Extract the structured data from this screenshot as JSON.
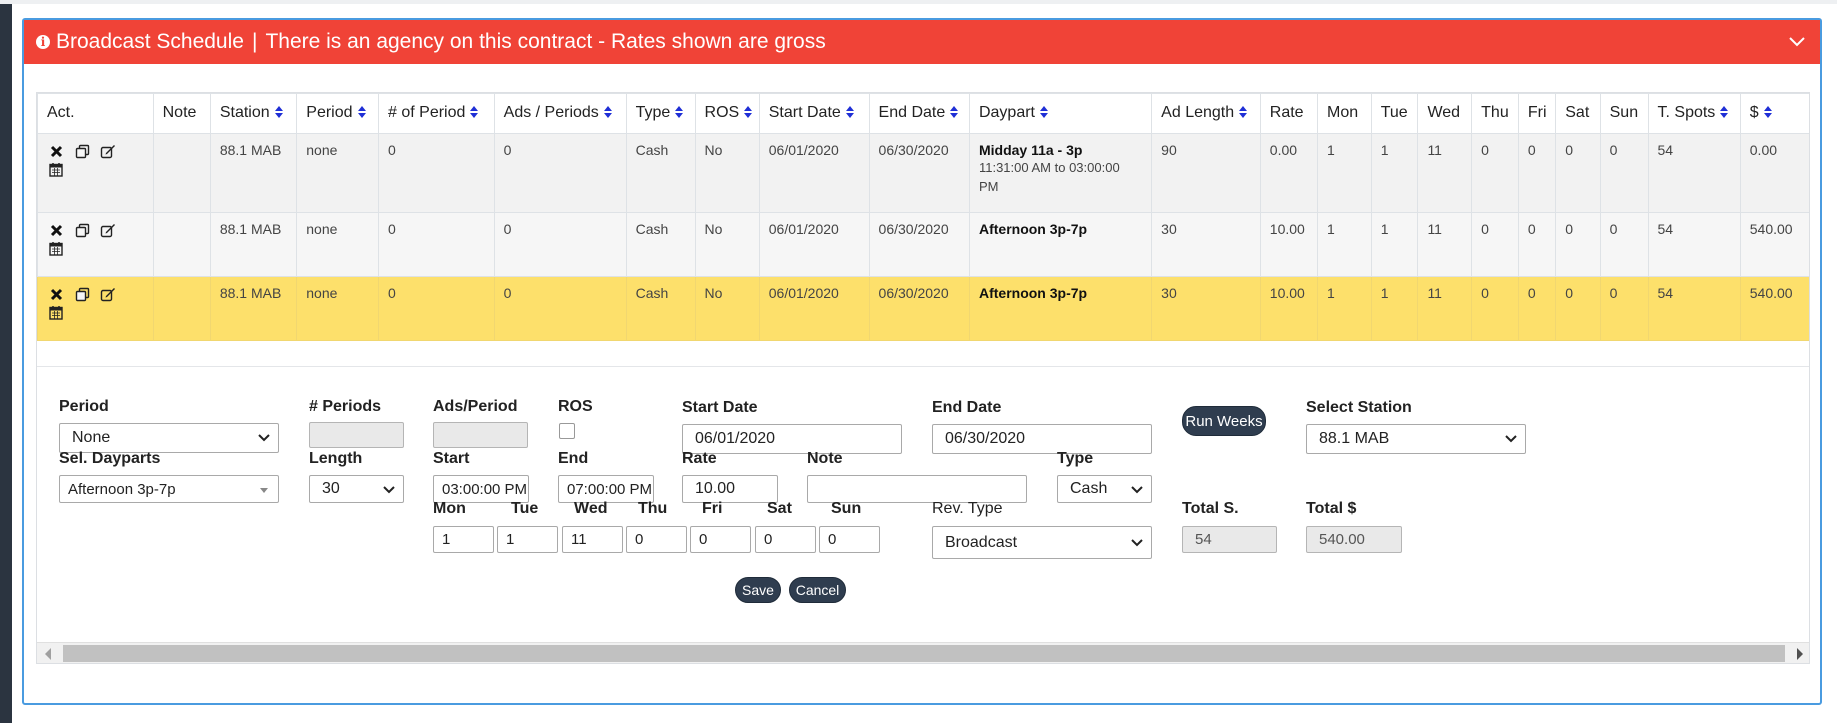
{
  "header": {
    "title": "Broadcast Schedule",
    "separator": "|",
    "message": "There is an agency on this contract - Rates shown are gross"
  },
  "table": {
    "columns": [
      "Act.",
      "Note",
      "Station",
      "Period",
      "# of Period",
      "Ads / Periods",
      "Type",
      "ROS",
      "Start Date",
      "End Date",
      "Daypart",
      "Ad Length",
      "Rate",
      "Mon",
      "Tue",
      "Wed",
      "Thu",
      "Fri",
      "Sat",
      "Sun",
      "T. Spots",
      "$"
    ],
    "sortable": [
      false,
      false,
      true,
      true,
      true,
      true,
      true,
      true,
      true,
      true,
      true,
      true,
      false,
      false,
      false,
      false,
      false,
      false,
      false,
      false,
      true,
      true
    ],
    "rows": [
      {
        "note": "",
        "station": "88.1 MAB",
        "period": "none",
        "num_period": "0",
        "ads_periods": "0",
        "type": "Cash",
        "ros": "No",
        "start": "06/01/2020",
        "end": "06/30/2020",
        "daypart": "Midday 11a - 3p",
        "daypart_time": "11:31:00 AM to 03:00:00 PM",
        "ad_length": "90",
        "rate": "0.00",
        "mon": "1",
        "tue": "1",
        "wed": "11",
        "thu": "0",
        "fri": "0",
        "sat": "0",
        "sun": "0",
        "spots": "54",
        "amount": "0.00"
      },
      {
        "note": "",
        "station": "88.1 MAB",
        "period": "none",
        "num_period": "0",
        "ads_periods": "0",
        "type": "Cash",
        "ros": "No",
        "start": "06/01/2020",
        "end": "06/30/2020",
        "daypart": "Afternoon 3p-7p",
        "daypart_time": "",
        "ad_length": "30",
        "rate": "10.00",
        "mon": "1",
        "tue": "1",
        "wed": "11",
        "thu": "0",
        "fri": "0",
        "sat": "0",
        "sun": "0",
        "spots": "54",
        "amount": "540.00"
      },
      {
        "note": "",
        "station": "88.1 MAB",
        "period": "none",
        "num_period": "0",
        "ads_periods": "0",
        "type": "Cash",
        "ros": "No",
        "start": "06/01/2020",
        "end": "06/30/2020",
        "daypart": "Afternoon 3p-7p",
        "daypart_time": "",
        "ad_length": "30",
        "rate": "10.00",
        "mon": "1",
        "tue": "1",
        "wed": "11",
        "thu": "0",
        "fri": "0",
        "sat": "0",
        "sun": "0",
        "spots": "54",
        "amount": "540.00"
      }
    ]
  },
  "form": {
    "period_label": "Period",
    "period_value": "None",
    "periods_label": "# Periods",
    "periods_value": "",
    "ads_period_label": "Ads/Period",
    "ads_period_value": "",
    "ros_label": "ROS",
    "start_date_label": "Start Date",
    "start_date_value": "06/01/2020",
    "end_date_label": "End Date",
    "end_date_value": "06/30/2020",
    "run_weeks_label": "Run Weeks",
    "select_station_label": "Select Station",
    "station_value": "88.1 MAB",
    "dayparts_label": "Sel. Dayparts",
    "dayparts_value": "Afternoon 3p-7p",
    "length_label": "Length",
    "length_value": "30",
    "start_label": "Start",
    "start_value": "03:00:00 PM",
    "end_label": "End",
    "end_value": "07:00:00 PM",
    "rate_label": "Rate",
    "rate_value": "10.00",
    "note_label": "Note",
    "note_value": "",
    "type_label": "Type",
    "type_value": "Cash",
    "days": [
      {
        "label": "Mon",
        "value": "1"
      },
      {
        "label": "Tue",
        "value": "1"
      },
      {
        "label": "Wed",
        "value": "11"
      },
      {
        "label": "Thu",
        "value": "0"
      },
      {
        "label": "Fri",
        "value": "0"
      },
      {
        "label": "Sat",
        "value": "0"
      },
      {
        "label": "Sun",
        "value": "0"
      }
    ],
    "rev_type_label": "Rev. Type",
    "rev_type_value": "Broadcast",
    "total_spots_label": "Total S.",
    "total_spots_value": "54",
    "total_amount_label": "Total $",
    "total_amount_value": "540.00",
    "save_label": "Save",
    "cancel_label": "Cancel"
  },
  "colors": {
    "header_bg": "#f04337",
    "selected_row": "#fde06b",
    "panel_border": "#4a9be0",
    "button_dark": "#2f3d4f",
    "sort_arrow": "#1f2fd6"
  },
  "icons": {
    "row_actions": [
      "close-icon",
      "copy-icon",
      "edit-icon",
      "calendar-icon"
    ],
    "header": [
      "info-icon",
      "chevron-down-icon"
    ]
  }
}
